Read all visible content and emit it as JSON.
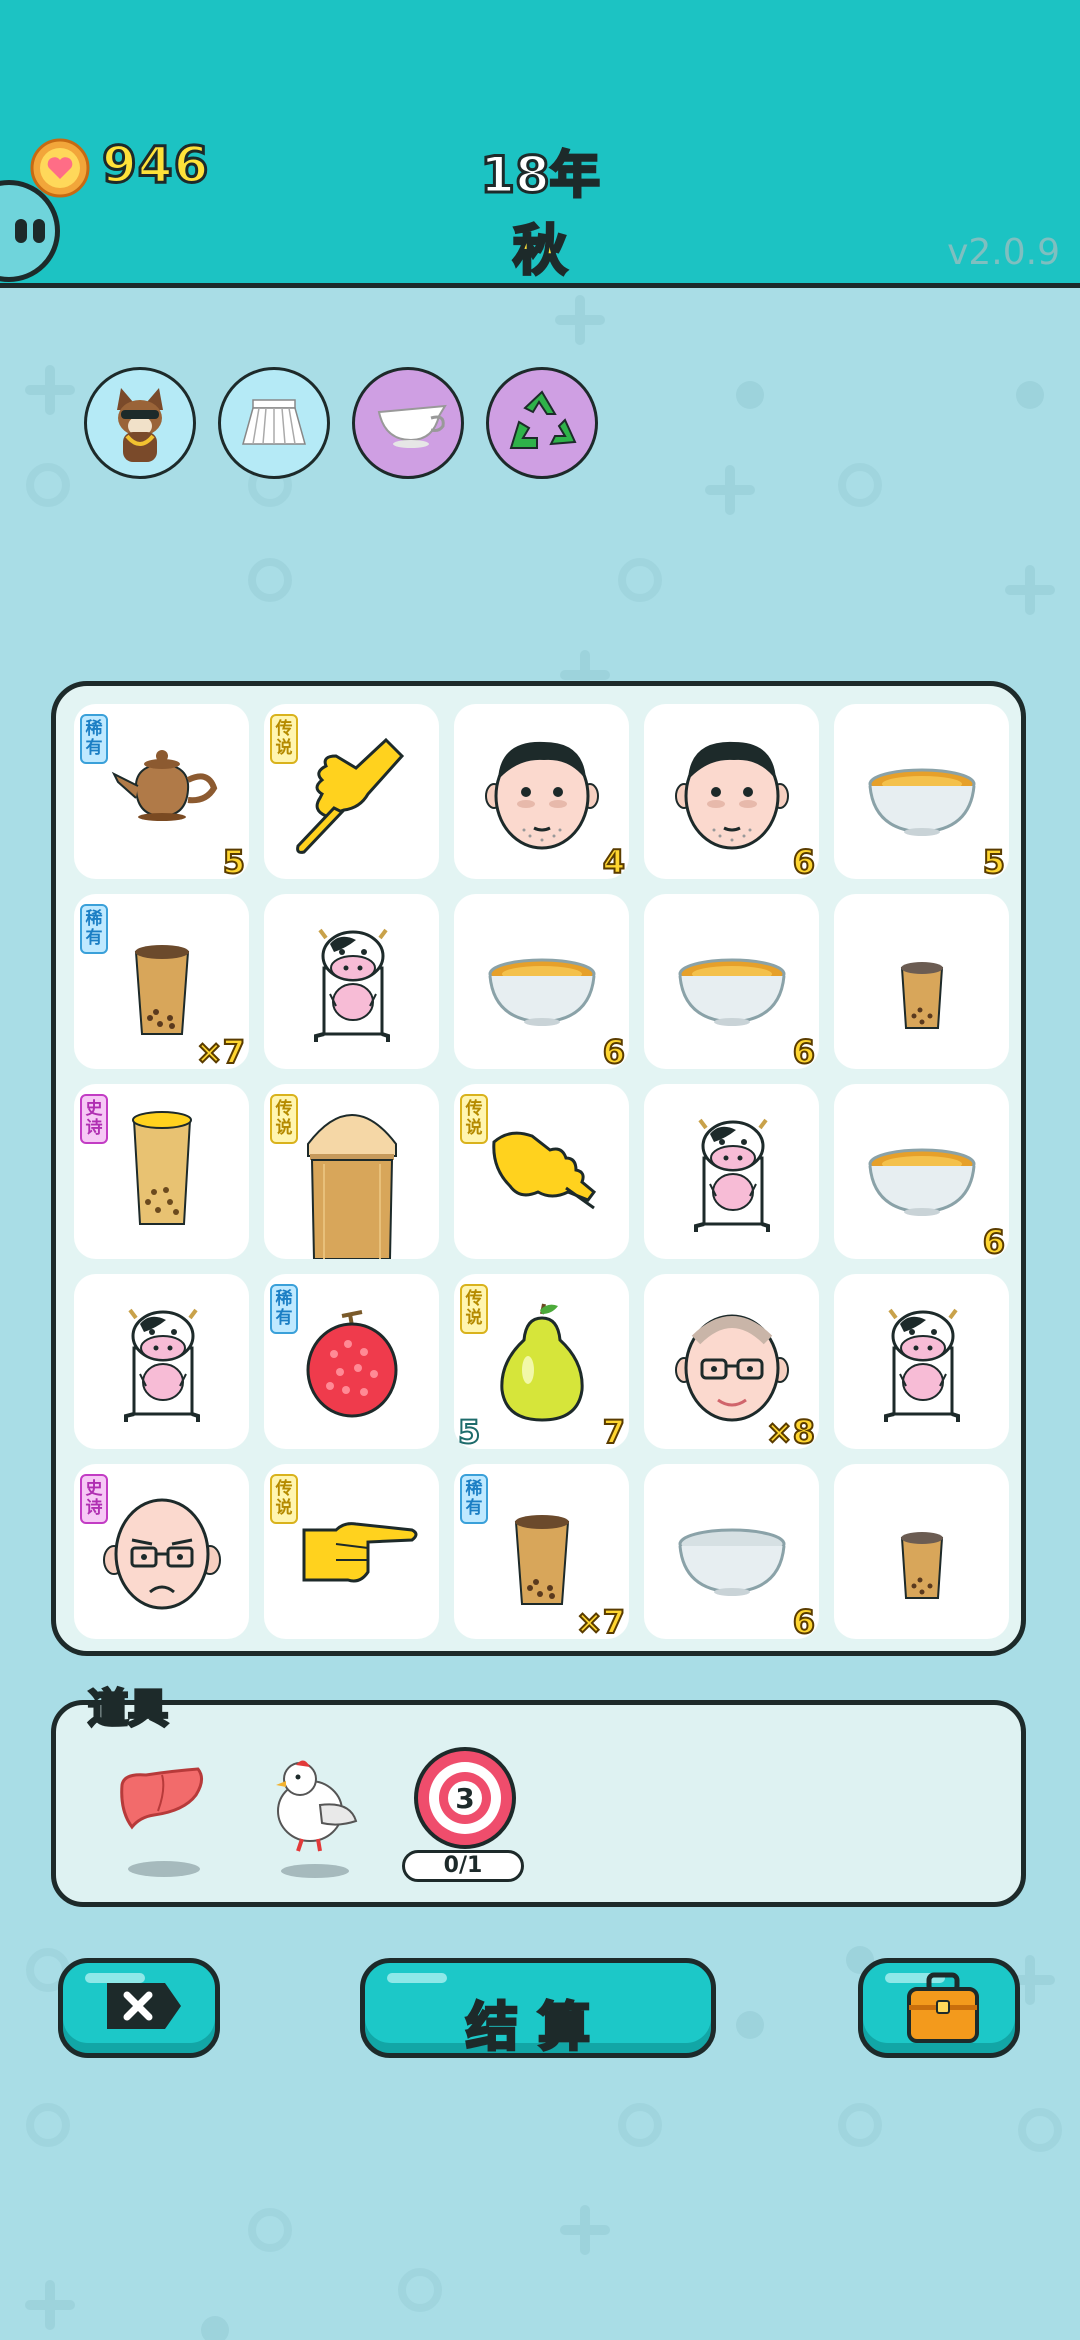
{
  "header": {
    "coins": "946",
    "year": "18年",
    "season": "秋",
    "version": "v2.0.9",
    "accent": "#1cc3c3"
  },
  "buffs": [
    "dog-with-sunglasses-icon",
    "pleated-skirt-icon",
    "gravy-boat-icon",
    "recycle-icon"
  ],
  "tags": {
    "rare": "稀有",
    "legend": "传说",
    "epic": "史诗"
  },
  "board": {
    "cells": [
      {
        "item": "teapot",
        "tag": "稀有",
        "br": "5",
        "bl": ""
      },
      {
        "item": "pointing-hand-down",
        "tag": "传说",
        "br": "",
        "bl": ""
      },
      {
        "item": "man-face",
        "tag": "",
        "br": "4",
        "bl": ""
      },
      {
        "item": "man-face",
        "tag": "",
        "br": "6",
        "bl": ""
      },
      {
        "item": "soup-bowl",
        "tag": "",
        "br": "5",
        "bl": ""
      },
      {
        "item": "boba-cup",
        "tag": "稀有",
        "br": "×7",
        "bl": ""
      },
      {
        "item": "cow",
        "tag": "",
        "br": "",
        "bl": ""
      },
      {
        "item": "soup-bowl",
        "tag": "",
        "br": "6",
        "bl": ""
      },
      {
        "item": "soup-bowl",
        "tag": "",
        "br": "6",
        "bl": ""
      },
      {
        "item": "boba-cup-small",
        "tag": "",
        "br": "",
        "bl": ""
      },
      {
        "item": "boba-cup-gold",
        "tag": "史诗",
        "br": "",
        "bl": ""
      },
      {
        "item": "boba-cup-large",
        "tag": "传说",
        "br": "",
        "bl": ""
      },
      {
        "item": "pointing-hand-right-down",
        "tag": "传说",
        "br": "",
        "bl": ""
      },
      {
        "item": "cow",
        "tag": "",
        "br": "",
        "bl": ""
      },
      {
        "item": "soup-bowl",
        "tag": "",
        "br": "6",
        "bl": ""
      },
      {
        "item": "cow",
        "tag": "",
        "br": "",
        "bl": ""
      },
      {
        "item": "lychee",
        "tag": "稀有",
        "br": "",
        "bl": ""
      },
      {
        "item": "pear",
        "tag": "传说",
        "br": "7",
        "bl": "5"
      },
      {
        "item": "old-man-glasses",
        "tag": "",
        "br": "×8",
        "bl": ""
      },
      {
        "item": "cow",
        "tag": "",
        "br": "",
        "bl": ""
      },
      {
        "item": "bald-man",
        "tag": "史诗",
        "br": "",
        "bl": ""
      },
      {
        "item": "pointing-hand-right",
        "tag": "传说",
        "br": "",
        "bl": ""
      },
      {
        "item": "boba-cup",
        "tag": "稀有",
        "br": "×7",
        "bl": ""
      },
      {
        "item": "empty-bowl",
        "tag": "",
        "br": "6",
        "bl": ""
      },
      {
        "item": "boba-cup-small",
        "tag": "",
        "br": "",
        "bl": ""
      }
    ]
  },
  "props": {
    "label": "道具",
    "items": [
      "liver-icon",
      "white-bird-icon",
      "target-icon"
    ],
    "target_count": "3",
    "progress": "0/1"
  },
  "buttons": {
    "delete_icon": "delete-icon",
    "settle": "结算",
    "bag_icon": "briefcase-icon"
  }
}
